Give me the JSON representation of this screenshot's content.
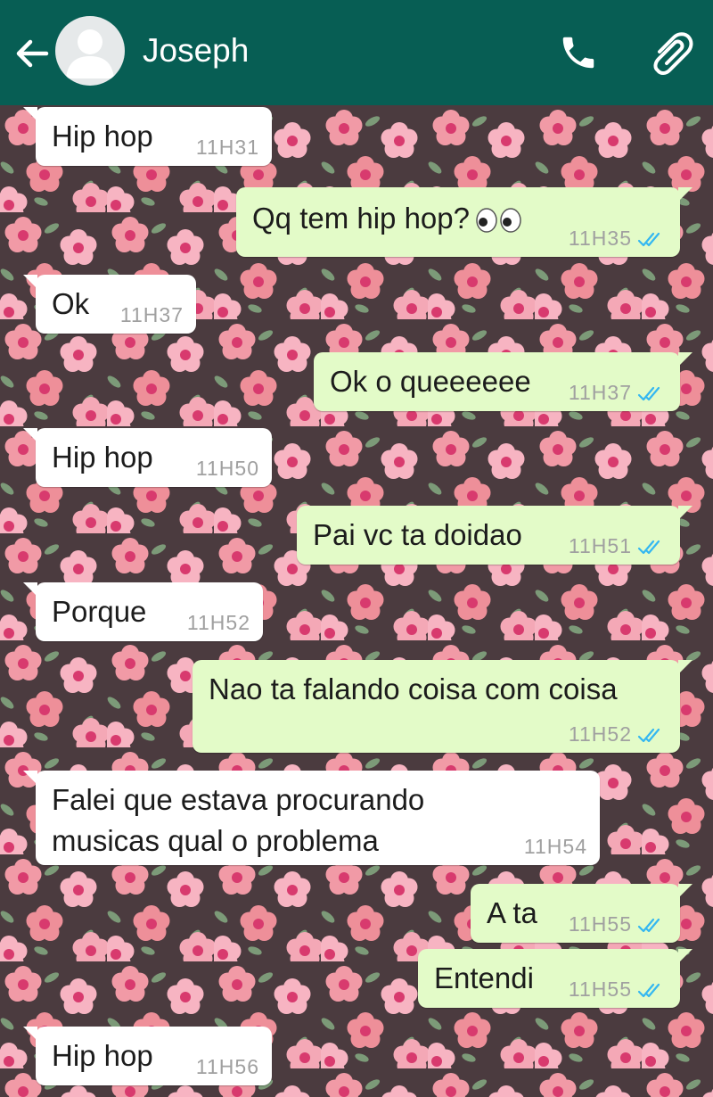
{
  "header": {
    "contact_name": "Joseph",
    "back_icon": "arrow-left-icon",
    "call_icon": "phone-icon",
    "attach_icon": "paperclip-icon"
  },
  "colors": {
    "header": "#075e54",
    "incoming_bubble": "#ffffff",
    "outgoing_bubble": "#e3fbc8",
    "read_ticks": "#34b7f1"
  },
  "messages": [
    {
      "dir": "in",
      "text": "Hip hop",
      "time": "11H31"
    },
    {
      "dir": "out",
      "text": "Qq tem hip hop?",
      "emoji": "eyes",
      "time": "11H35",
      "status": "read"
    },
    {
      "dir": "in",
      "text": "Ok",
      "time": "11H37"
    },
    {
      "dir": "out",
      "text": "Ok o queeeeee",
      "time": "11H37",
      "status": "read"
    },
    {
      "dir": "in",
      "text": "Hip hop",
      "time": "11H50"
    },
    {
      "dir": "out",
      "text": "Pai vc ta doidao",
      "time": "11H51",
      "status": "read"
    },
    {
      "dir": "in",
      "text": "Porque",
      "time": "11H52"
    },
    {
      "dir": "out",
      "text": "Nao ta falando coisa com coisa",
      "time": "11H52",
      "status": "read"
    },
    {
      "dir": "in",
      "text": "Falei que estava procurando\nmusicas qual o problema",
      "time": "11H54"
    },
    {
      "dir": "out",
      "text": "A ta",
      "time": "11H55",
      "status": "read"
    },
    {
      "dir": "out",
      "text": "Entendi",
      "time": "11H55",
      "status": "read"
    },
    {
      "dir": "in",
      "text": "Hip hop",
      "time": "11H56"
    }
  ]
}
